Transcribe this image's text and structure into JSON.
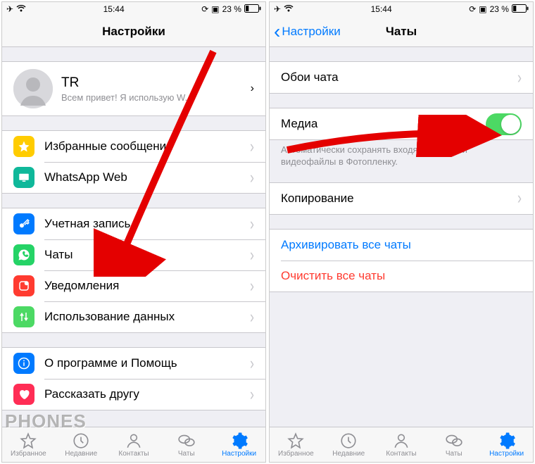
{
  "status": {
    "time": "15:44",
    "battery": "23 %"
  },
  "left": {
    "title": "Настройки",
    "profile": {
      "name": "TR",
      "status": "Всем привет! Я использую W..."
    },
    "group2": [
      {
        "label": "Избранные сообщения"
      },
      {
        "label": "WhatsApp Web"
      }
    ],
    "group3": [
      {
        "label": "Учетная запись"
      },
      {
        "label": "Чаты"
      },
      {
        "label": "Уведомления"
      },
      {
        "label": "Использование данных"
      }
    ],
    "group4": [
      {
        "label": "О программе и Помощь"
      },
      {
        "label": "Рассказать другу"
      }
    ]
  },
  "right": {
    "back": "Настройки",
    "title": "Чаты",
    "wallpaper": "Обои чата",
    "media": "Медиа",
    "media_note": "Автоматически сохранять входящие фото и видеофайлы в Фотопленку.",
    "backup": "Копирование",
    "archive": "Архивировать все чаты",
    "clear": "Очистить все чаты"
  },
  "tabs": [
    "Избранное",
    "Недавние",
    "Контакты",
    "Чаты",
    "Настройки"
  ],
  "watermark": "PHONES"
}
